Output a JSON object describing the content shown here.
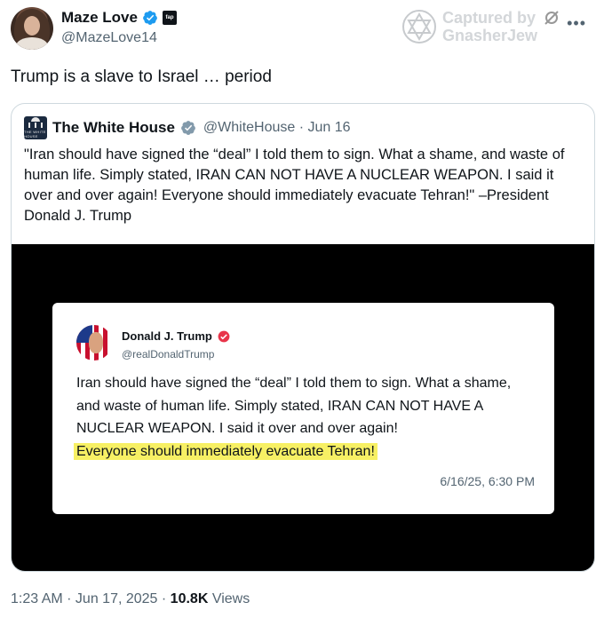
{
  "author": {
    "display_name": "Maze Love",
    "handle": "@MazeLove14",
    "affiliate_badge_text": "fap"
  },
  "watermark": {
    "line1": "Captured by",
    "line2": "GnasherJew"
  },
  "tweet": {
    "text": "Trump is a slave to Israel … period"
  },
  "quote": {
    "logo_text": "THE WHITE HOUSE",
    "display_name": "The White House",
    "handle_date": "@WhiteHouse · Jun 16",
    "text": "\"Iran should have signed the “deal” I told them to sign. What a shame, and waste of human life. Simply stated, IRAN CAN NOT HAVE A NUCLEAR WEAPON. I said it over and over again! Everyone should immediately evacuate Tehran!\" –President Donald J. Trump"
  },
  "embedded_post": {
    "display_name": "Donald J. Trump",
    "handle": "@realDonaldTrump",
    "text_plain": "Iran should have signed the “deal” I told them to sign. What a shame, and waste of human life. Simply stated, IRAN CAN NOT HAVE A NUCLEAR WEAPON. I said it over and over again!",
    "text_highlighted": "Everyone should immediately evacuate Tehran!",
    "timestamp": "6/16/25, 6:30 PM"
  },
  "footer": {
    "time_date": "1:23 AM · Jun 17, 2025 · ",
    "views_count": "10.8K",
    "views_label": " Views"
  },
  "colors": {
    "verified_blue": "#1d9bf0",
    "truth_social_red": "#e8354a",
    "highlight_yellow": "#f7f064",
    "secondary_text": "#536471"
  },
  "icons": [
    "verified-badge-icon",
    "affiliate-badge-icon",
    "star-of-david-icon",
    "fork-icon",
    "more-icon",
    "white-house-logo",
    "truth-verified-icon"
  ]
}
